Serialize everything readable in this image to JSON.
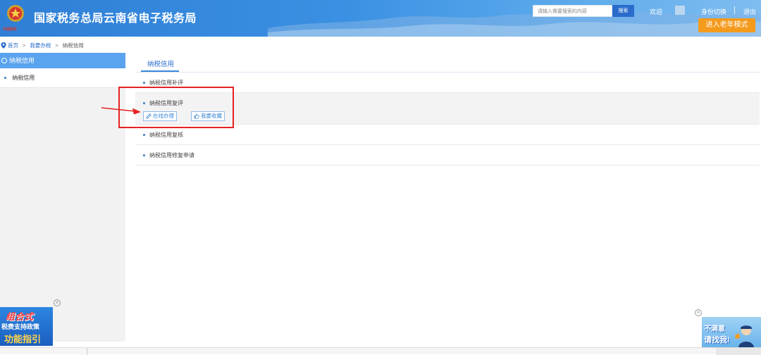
{
  "header": {
    "title": "国家税务总局云南省电子税务局",
    "emblem_caption": "中国税务",
    "search": {
      "placeholder": "请输入需要搜索的内容",
      "button": "搜索"
    },
    "welcome": "欢迎",
    "switch_identity": "身份切换",
    "separator": "|",
    "logout": "退出",
    "elder_mode": "进入老年模式",
    "brand_color": "#3a90e2",
    "elder_color": "#f49a1c"
  },
  "breadcrumb": {
    "icon": "location-pin-icon",
    "items": [
      "首页",
      "我要办税",
      "纳税信用"
    ],
    "separator": ">"
  },
  "sidebar": {
    "header": "纳税信用",
    "items": [
      {
        "label": "纳税信用"
      }
    ]
  },
  "main": {
    "tab": "纳税信用",
    "rows": [
      {
        "label": "纳税信用补评"
      },
      {
        "label": "纳税信用复评",
        "actions": [
          "在线办理",
          "我要收藏"
        ]
      },
      {
        "label": "纳税信用复核"
      },
      {
        "label": "纳税信用修复申请"
      }
    ]
  },
  "promo_left": {
    "line1": "组合式",
    "line2": "税费支持政策",
    "line3": "功能指引"
  },
  "promo_right": {
    "line1": "不满意",
    "line2": "请找我!"
  },
  "close_glyph": "×",
  "annotation_color": "#e52222"
}
